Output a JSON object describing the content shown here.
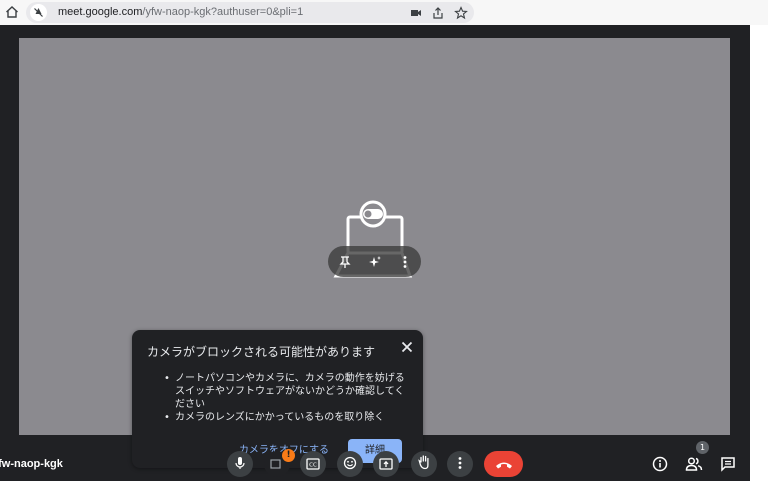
{
  "browser": {
    "url_host": "meet.google.com",
    "url_path": "/yfw-naop-kgk?authuser=0&pli=1"
  },
  "popup": {
    "title": "カメラがブロックされる可能性があります",
    "items": [
      "ノートパソコンやカメラに、カメラの動作を妨げるスイッチやソフトウェアがないかどうか確認してください",
      "カメラのレンズにかかっているものを取り除く"
    ],
    "turn_off_label": "カメラをオフにする",
    "details_label": "詳細"
  },
  "meeting": {
    "code": "yfw-naop-kgk",
    "camera_warning_badge": "!",
    "participant_count": "1"
  },
  "icons": {
    "home": "home-icon",
    "site_info": "site-info-icon",
    "camera_blocked": "camera-blocked-icon",
    "share": "share-icon",
    "bookmark": "star-icon",
    "pin": "pin-icon",
    "effects": "sparkle-icon",
    "more_tile": "more-vert-icon",
    "close": "close-icon",
    "mic": "mic-icon",
    "camera": "camera-icon",
    "captions": "captions-icon",
    "emoji": "emoji-icon",
    "present": "present-icon",
    "raise_hand": "hand-icon",
    "more": "more-vert-icon",
    "end_call": "end-call-icon",
    "info": "info-icon",
    "people": "people-icon",
    "chat": "chat-icon"
  },
  "colors": {
    "background": "#202124",
    "tile": "#8b8a8f",
    "end_call": "#ea4335",
    "accent_blue": "#8ab4f8",
    "warning": "#fa7b17"
  }
}
